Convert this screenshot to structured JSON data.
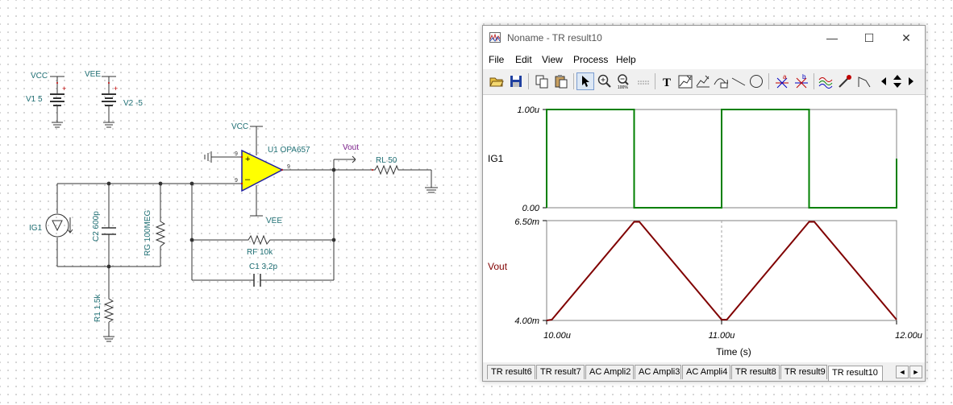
{
  "schematic": {
    "vcc1": "VCC",
    "v1": "V1 5",
    "vee1": "VEE",
    "v2": "V2 -5",
    "vcc2": "VCC",
    "vee2": "VEE",
    "u1": "U1 OPA657",
    "vout": "Vout",
    "rl": "RL 50",
    "ig1": "IG1",
    "c2": "C2 600p",
    "rg": "RG 100MEG",
    "rf": "RF 10k",
    "c1": "C1 3,2p",
    "r1": "R1 1,5k",
    "pin9a": "9",
    "pin9b": "9",
    "pin9c": "9"
  },
  "window": {
    "title": "Noname - TR result10",
    "minimize": "—",
    "maximize": "☐",
    "close": "✕",
    "menu": [
      "File",
      "Edit",
      "View",
      "Process",
      "Help"
    ]
  },
  "toolbar": {
    "icons": [
      "open-icon",
      "save-icon",
      "copy-icon",
      "paste-icon",
      "pointer-icon",
      "zoom-in-icon",
      "zoom-out-icon",
      "grid-icon",
      "text-icon",
      "cursor-a-icon",
      "cursor-b-icon",
      "curve-icon",
      "line-icon",
      "circle-icon",
      "marker-a-icon",
      "marker-b-icon",
      "waveform-icon",
      "probe-icon",
      "pulse-icon",
      "scroll-left-icon",
      "scroll-up-down-icon",
      "scroll-right-icon"
    ]
  },
  "plot": {
    "ig1_label": "IG1",
    "vout_label": "Vout",
    "ig1_ymax": "1.00u",
    "ig1_ymin": "0.00",
    "vout_ymax": "6.50m",
    "vout_ymin": "4.00m",
    "x_ticks": [
      "10.00u",
      "11.00u",
      "12.00u"
    ],
    "xlabel": "Time (s)",
    "colors": {
      "ig1": "#008000",
      "vout": "#800000"
    }
  },
  "chart_data": [
    {
      "type": "line",
      "title": "",
      "xlabel": "Time (s)",
      "ylabel": "IG1",
      "xlim": [
        1e-05,
        1.2e-05
      ],
      "ylim": [
        0,
        1e-06
      ],
      "series": [
        {
          "name": "IG1",
          "x": [
            1e-05,
            1e-05,
            1.05e-05,
            1.05e-05,
            1.1e-05,
            1.1e-05,
            1.15e-05,
            1.15e-05,
            1.2e-05,
            1.2e-05
          ],
          "y": [
            0,
            1e-06,
            1e-06,
            0,
            0,
            1e-06,
            1e-06,
            0,
            0,
            5e-07
          ]
        }
      ]
    },
    {
      "type": "line",
      "title": "",
      "xlabel": "Time (s)",
      "ylabel": "Vout",
      "xlim": [
        1e-05,
        1.2e-05
      ],
      "ylim": [
        0.004,
        0.0065
      ],
      "series": [
        {
          "name": "Vout",
          "x": [
            1e-05,
            1.003e-05,
            1.05e-05,
            1.053e-05,
            1.1e-05,
            1.103e-05,
            1.15e-05,
            1.153e-05,
            1.2e-05
          ],
          "y": [
            0.004,
            0.00402,
            0.00647,
            0.00647,
            0.00402,
            0.00402,
            0.00647,
            0.00647,
            0.00402
          ]
        }
      ]
    }
  ],
  "tabs": [
    "TR result6",
    "TR result7",
    "AC Ampli2",
    "AC Ampli3",
    "AC Ampli4",
    "TR result8",
    "TR result9",
    "TR result10"
  ],
  "active_tab": "TR result10",
  "tab_nav": {
    "left": "◄",
    "right": "►"
  }
}
